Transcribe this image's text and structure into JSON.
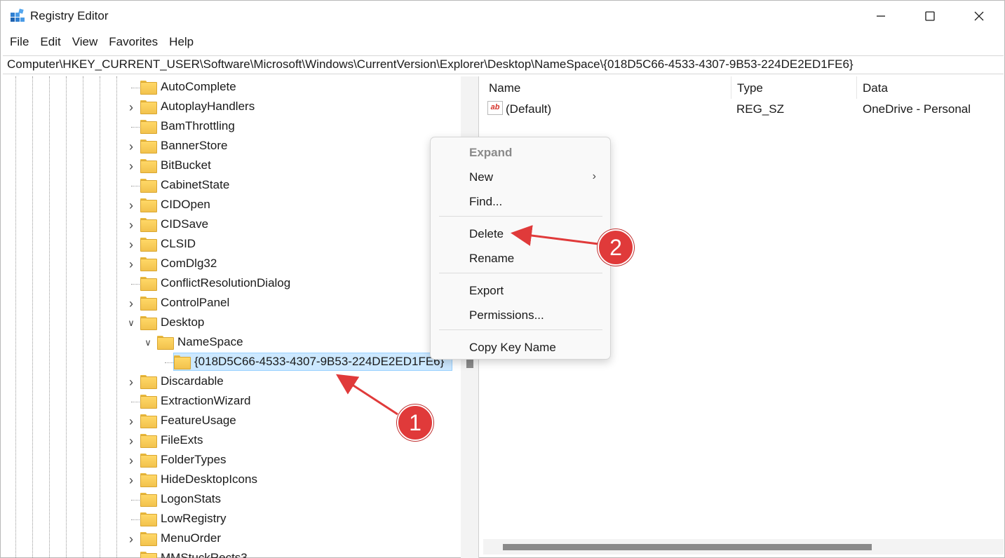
{
  "window": {
    "title": "Registry Editor",
    "controls": {
      "minimize": "minimize",
      "maximize": "maximize",
      "close": "close"
    }
  },
  "menubar": [
    "File",
    "Edit",
    "View",
    "Favorites",
    "Help"
  ],
  "address": "Computer\\HKEY_CURRENT_USER\\Software\\Microsoft\\Windows\\CurrentVersion\\Explorer\\Desktop\\NameSpace\\{018D5C66-4533-4307-9B53-224DE2ED1FE6}",
  "tree": {
    "items": [
      {
        "label": "AutoComplete",
        "expandable": false
      },
      {
        "label": "AutoplayHandlers",
        "expandable": true
      },
      {
        "label": "BamThrottling",
        "expandable": false
      },
      {
        "label": "BannerStore",
        "expandable": true
      },
      {
        "label": "BitBucket",
        "expandable": true
      },
      {
        "label": "CabinetState",
        "expandable": false
      },
      {
        "label": "CIDOpen",
        "expandable": true
      },
      {
        "label": "CIDSave",
        "expandable": true
      },
      {
        "label": "CLSID",
        "expandable": true
      },
      {
        "label": "ComDlg32",
        "expandable": true
      },
      {
        "label": "ConflictResolutionDialog",
        "expandable": false
      },
      {
        "label": "ControlPanel",
        "expandable": true
      },
      {
        "label": "Desktop",
        "expandable": true,
        "expanded": true
      },
      {
        "label": "NameSpace",
        "expandable": true,
        "expanded": true,
        "level": 1
      },
      {
        "label": "{018D5C66-4533-4307-9B53-224DE2ED1FE6}",
        "expandable": false,
        "level": 2,
        "selected": true
      },
      {
        "label": "Discardable",
        "expandable": true
      },
      {
        "label": "ExtractionWizard",
        "expandable": false
      },
      {
        "label": "FeatureUsage",
        "expandable": true
      },
      {
        "label": "FileExts",
        "expandable": true
      },
      {
        "label": "FolderTypes",
        "expandable": true
      },
      {
        "label": "HideDesktopIcons",
        "expandable": true
      },
      {
        "label": "LogonStats",
        "expandable": false
      },
      {
        "label": "LowRegistry",
        "expandable": false
      },
      {
        "label": "MenuOrder",
        "expandable": true
      },
      {
        "label": "MMStuckRects3",
        "expandable": false
      }
    ]
  },
  "values": {
    "headers": {
      "name": "Name",
      "type": "Type",
      "data": "Data"
    },
    "rows": [
      {
        "name": "(Default)",
        "type": "REG_SZ",
        "data": "OneDrive - Personal",
        "icon": "string-value-icon",
        "icon_text": "ab"
      }
    ]
  },
  "context_menu": {
    "items": [
      {
        "label": "Expand",
        "disabled": true
      },
      {
        "label": "New",
        "submenu": true
      },
      {
        "label": "Find..."
      },
      {
        "label": "Delete"
      },
      {
        "label": "Rename"
      },
      {
        "label": "Export"
      },
      {
        "label": "Permissions..."
      },
      {
        "label": "Copy Key Name"
      }
    ]
  },
  "annotations": [
    {
      "number": "1",
      "target": "selected-key"
    },
    {
      "number": "2",
      "target": "delete-menu-item"
    }
  ],
  "colors": {
    "selection": "#cce8ff",
    "annotation": "#e03a3a",
    "folder": "#f2c24d"
  }
}
